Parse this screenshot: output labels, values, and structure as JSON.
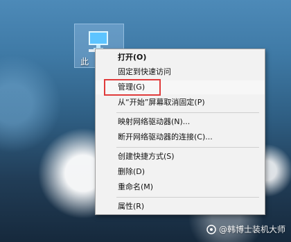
{
  "desktop_icon": {
    "name": "this-pc-icon",
    "label": "此"
  },
  "context_menu": {
    "items": [
      {
        "label": "打开(O)",
        "bold": true
      },
      {
        "label": "固定到快速访问",
        "bold": false
      },
      {
        "label": "管理(G)",
        "bold": false,
        "highlighted": true
      },
      {
        "label": "从“开始”屏幕取消固定(P)",
        "bold": false
      },
      {
        "label": "映射网络驱动器(N)...",
        "bold": false
      },
      {
        "label": "断开网络驱动器的连接(C)...",
        "bold": false
      },
      {
        "label": "创建快捷方式(S)",
        "bold": false
      },
      {
        "label": "删除(D)",
        "bold": false
      },
      {
        "label": "重命名(M)",
        "bold": false
      },
      {
        "label": "属性(R)",
        "bold": false
      }
    ]
  },
  "watermark": {
    "text": "@韩博士装机大师"
  }
}
